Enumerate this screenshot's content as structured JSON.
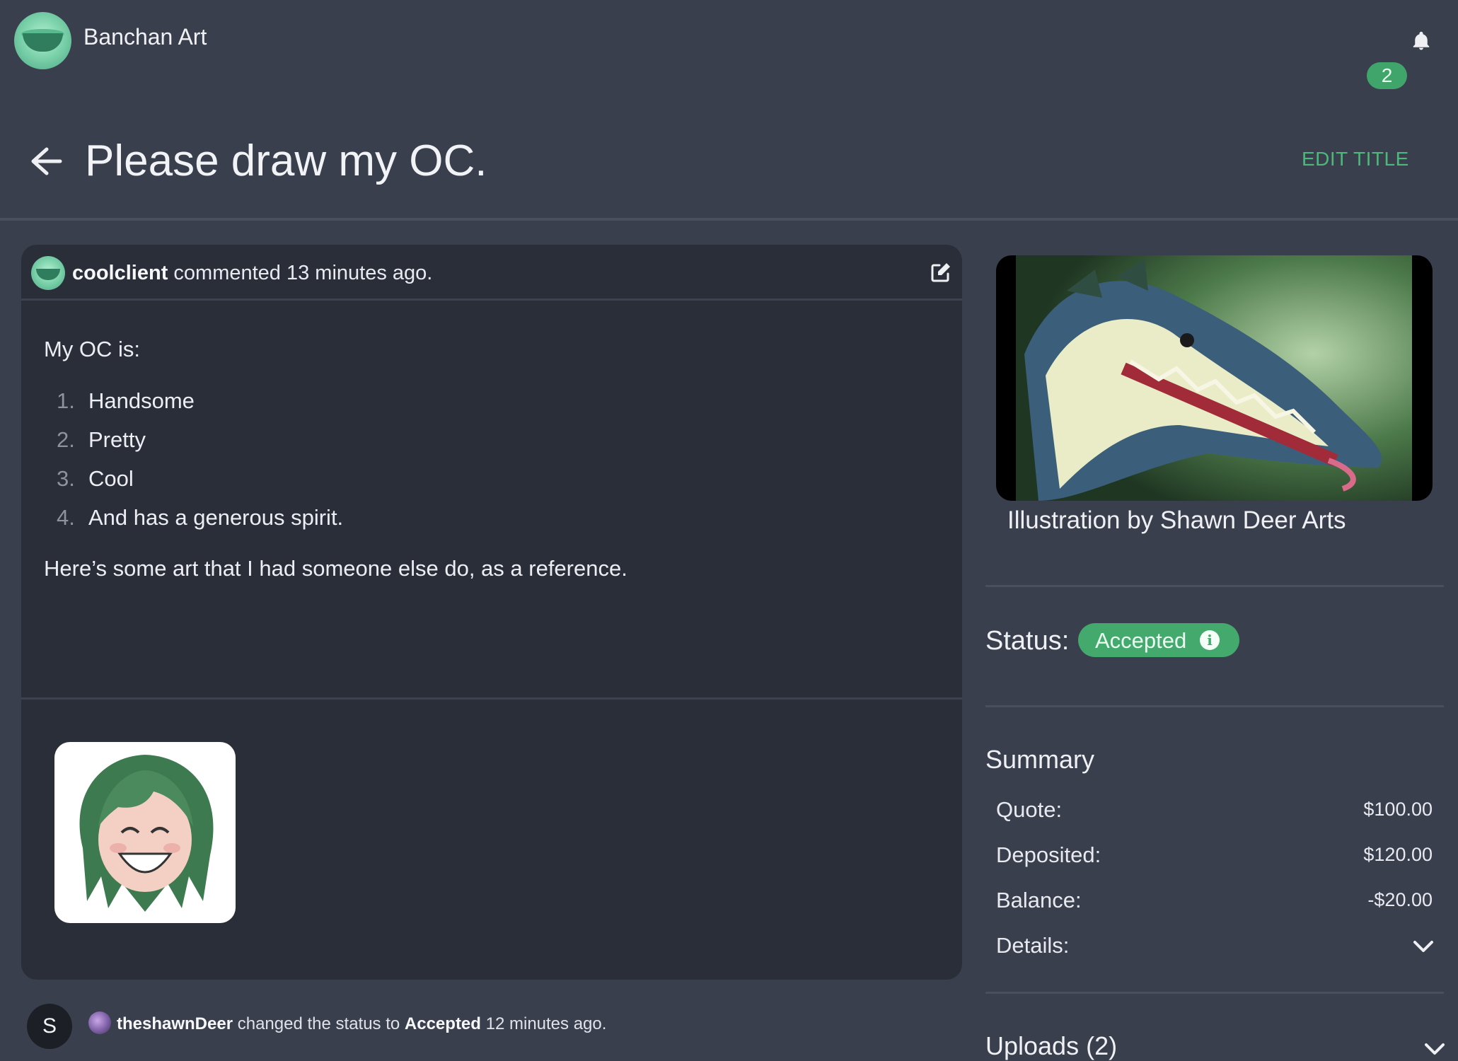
{
  "brand": {
    "name": "Banchan Art",
    "logo_icon": "banchan-bowl-logo"
  },
  "notifications": {
    "count": "2",
    "icon": "bell-icon"
  },
  "page": {
    "title": "Please draw my OC.",
    "edit_title_label": "EDIT TITLE",
    "back_icon": "arrow-left-icon"
  },
  "comment": {
    "author": "coolclient",
    "meta_text": "commented 13 minutes ago.",
    "intro": "My OC is:",
    "list": [
      {
        "num": "1.",
        "text": "Handsome"
      },
      {
        "num": "2.",
        "text": "Pretty"
      },
      {
        "num": "3.",
        "text": "Cool"
      },
      {
        "num": "4.",
        "text": "And has a generous spirit."
      }
    ],
    "outro": "Here’s some art that I had someone else do, as a reference.",
    "edit_icon": "edit-icon"
  },
  "activity": {
    "avatar_letter": "S",
    "user": "theshawnDeer",
    "text_before": "changed the status to",
    "status": "Accepted",
    "text_after": "12 minutes ago."
  },
  "sidebar": {
    "caption": "Illustration by Shawn Deer Arts",
    "status_label": "Status:",
    "status_value": "Accepted",
    "status_color": "#43a96d",
    "summary_title": "Summary",
    "summary": [
      {
        "label": "Quote:",
        "value": "$100.00"
      },
      {
        "label": "Deposited:",
        "value": "$120.00"
      },
      {
        "label": "Balance:",
        "value": "-$20.00"
      }
    ],
    "details_label": "Details:",
    "uploads_label": "Uploads (2)"
  },
  "colors": {
    "accent": "#4cb879",
    "background": "#3a3f4d",
    "card": "#2a2e38"
  }
}
